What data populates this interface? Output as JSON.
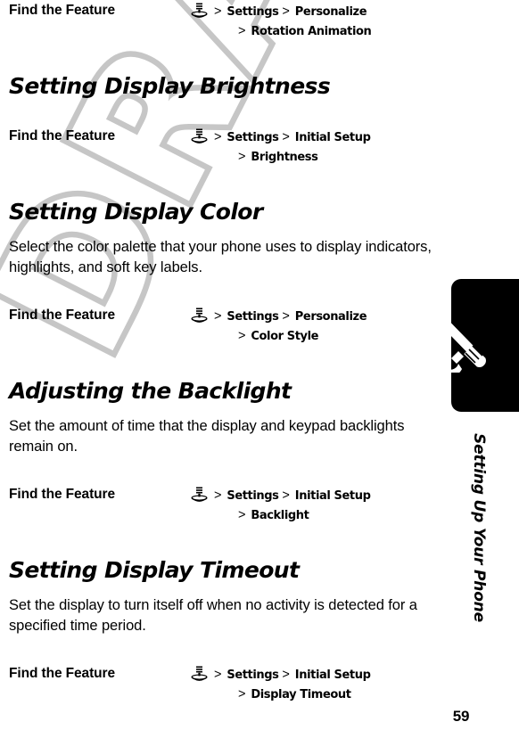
{
  "document": {
    "watermark": "DRAFT",
    "page_number": "59",
    "chapter_label": "Setting Up Your Phone",
    "chapter_icon": "tools-wrench-screwdriver-icon"
  },
  "blocks": [
    {
      "type": "find_feature",
      "label": "Find the Feature",
      "icon": "joystick-navigation-key-icon",
      "lines": [
        {
          "items": [
            "Settings",
            "Personalize"
          ]
        },
        {
          "items": [
            "Rotation Animation"
          ],
          "indent": true
        }
      ]
    },
    {
      "type": "heading",
      "text": "Setting Display Brightness"
    },
    {
      "type": "find_feature",
      "label": "Find the Feature",
      "icon": "joystick-navigation-key-icon",
      "lines": [
        {
          "items": [
            "Settings",
            "Initial Setup"
          ]
        },
        {
          "items": [
            "Brightness"
          ],
          "indent": true
        }
      ]
    },
    {
      "type": "heading",
      "text": "Setting Display Color"
    },
    {
      "type": "paragraph",
      "text": "Select the color palette that your phone uses to display indicators, highlights, and soft key labels."
    },
    {
      "type": "find_feature",
      "label": "Find the Feature",
      "icon": "joystick-navigation-key-icon",
      "lines": [
        {
          "items": [
            "Settings",
            "Personalize"
          ]
        },
        {
          "items": [
            "Color Style"
          ],
          "indent": true
        }
      ]
    },
    {
      "type": "heading",
      "text": "Adjusting the Backlight"
    },
    {
      "type": "paragraph",
      "text": "Set the amount of time that the display and keypad backlights remain on."
    },
    {
      "type": "find_feature",
      "label": "Find the Feature",
      "icon": "joystick-navigation-key-icon",
      "lines": [
        {
          "items": [
            "Settings",
            "Initial Setup"
          ]
        },
        {
          "items": [
            "Backlight"
          ],
          "indent": true
        }
      ]
    },
    {
      "type": "heading",
      "text": "Setting Display Timeout"
    },
    {
      "type": "paragraph",
      "text": "Set the display to turn itself off when no activity is detected for a specified time period."
    },
    {
      "type": "find_feature",
      "label": "Find the Feature",
      "icon": "joystick-navigation-key-icon",
      "lines": [
        {
          "items": [
            "Settings",
            "Initial Setup"
          ]
        },
        {
          "items": [
            "Display Timeout"
          ],
          "indent": true
        }
      ]
    }
  ],
  "symbols": {
    "chevron": ">"
  },
  "colors": {
    "text": "#000000",
    "watermark_gray": "#c3c3c3",
    "tab_black": "#000000",
    "page_background": "#ffffff"
  }
}
